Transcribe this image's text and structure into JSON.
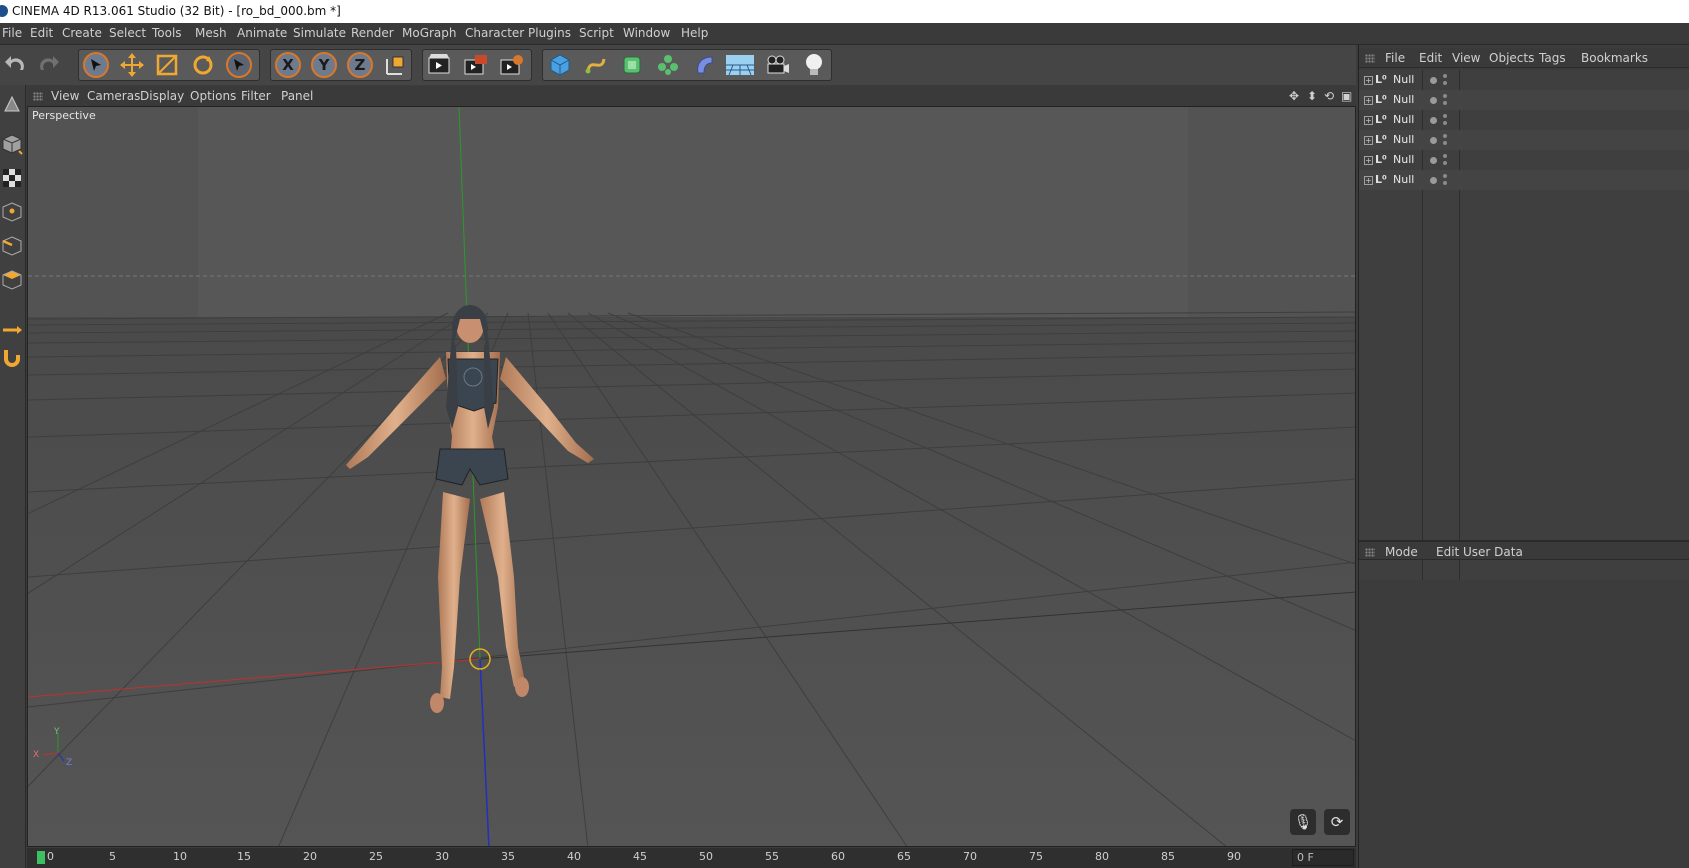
{
  "window": {
    "title": "CINEMA 4D R13.061 Studio (32 Bit) - [ro_bd_000.bm *]"
  },
  "menubar": {
    "items": [
      "File",
      "Edit",
      "Create",
      "Select",
      "Tools",
      "Mesh",
      "Animate",
      "Simulate",
      "Render",
      "MoGraph",
      "Character",
      "Plugins",
      "Script",
      "Window",
      "Help"
    ]
  },
  "toolbar": {
    "undo_icon": "undo-icon",
    "redo_icon": "redo-icon",
    "axis_x": "X",
    "axis_y": "Y",
    "axis_z": "Z"
  },
  "viewport": {
    "menu": [
      "View",
      "Cameras",
      "Display",
      "Options",
      "Filter",
      "Panel"
    ],
    "label": "Perspective",
    "axis_gizmo": {
      "x": "X",
      "y": "Y",
      "z": "Z"
    }
  },
  "timeline": {
    "ticks": [
      "0",
      "5",
      "10",
      "15",
      "20",
      "25",
      "30",
      "35",
      "40",
      "45",
      "50",
      "55",
      "60",
      "65",
      "70",
      "75",
      "80",
      "85",
      "90"
    ],
    "frame_value": "0 F"
  },
  "object_manager": {
    "menu": [
      "File",
      "Edit",
      "View",
      "Objects",
      "Tags",
      "Bookmarks"
    ],
    "objects": [
      {
        "name": "Null"
      },
      {
        "name": "Null"
      },
      {
        "name": "Null"
      },
      {
        "name": "Null"
      },
      {
        "name": "Null"
      },
      {
        "name": "Null"
      }
    ]
  },
  "attribute_manager": {
    "menu": [
      "Mode",
      "Edit",
      "User Data"
    ]
  },
  "colors": {
    "accent_orange": "#d9782a",
    "viewport_bg": "#565656",
    "panel_bg": "#3c3c3c"
  }
}
